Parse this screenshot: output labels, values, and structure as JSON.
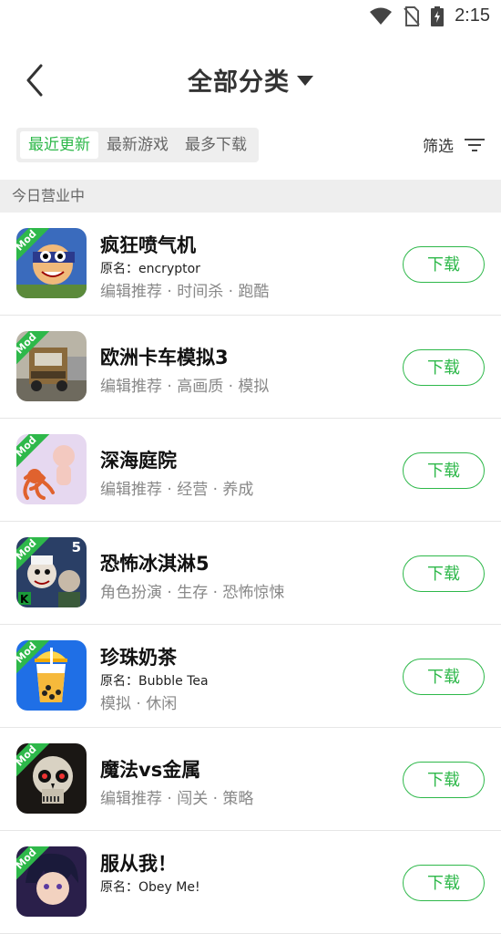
{
  "status": {
    "time": "2:15"
  },
  "header": {
    "title": "全部分类"
  },
  "tabs": [
    {
      "label": "最近更新",
      "active": true
    },
    {
      "label": "最新游戏",
      "active": false
    },
    {
      "label": "最多下载",
      "active": false
    }
  ],
  "filter": {
    "label": "筛选"
  },
  "section": {
    "title": "今日营业中"
  },
  "mod_badge": "Mod",
  "apps": [
    {
      "name": "疯狂喷气机",
      "original": "原名：encryptor",
      "tags": "编辑推荐 · 时间杀 · 跑酷",
      "button": "下载",
      "icon": "jetpack-icon"
    },
    {
      "name": "欧洲卡车模拟3",
      "original": "",
      "tags": "编辑推荐 · 高画质 · 模拟",
      "button": "下载",
      "icon": "truck-icon"
    },
    {
      "name": "深海庭院",
      "original": "",
      "tags": "编辑推荐 · 经营 · 养成",
      "button": "下载",
      "icon": "octopus-icon"
    },
    {
      "name": "恐怖冰淇淋5",
      "original": "",
      "tags": "角色扮演 · 生存 · 恐怖惊悚",
      "button": "下载",
      "icon": "ice-scream-icon",
      "number_badge": "5"
    },
    {
      "name": "珍珠奶茶",
      "original": "原名：Bubble Tea",
      "tags": "模拟 · 休闲",
      "button": "下载",
      "icon": "bubble-tea-icon"
    },
    {
      "name": "魔法vs金属",
      "original": "",
      "tags": "编辑推荐 · 闯关 · 策略",
      "button": "下载",
      "icon": "skull-icon"
    },
    {
      "name": "服从我！",
      "original": "原名：Obey Me!",
      "tags": "",
      "button": "下载",
      "icon": "anime-character-icon"
    }
  ],
  "colors": {
    "accent": "#2eb84a",
    "section_bg": "#eeeeee"
  }
}
